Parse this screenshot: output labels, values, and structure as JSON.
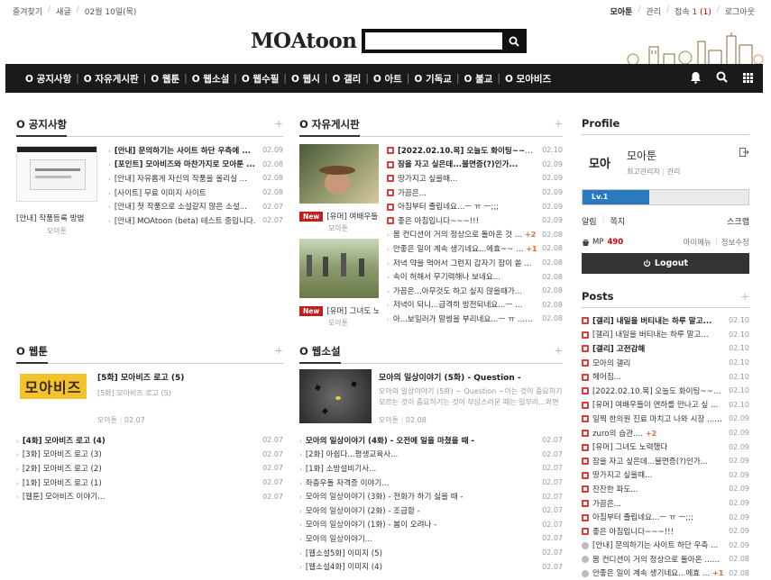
{
  "topbar": {
    "left": [
      "즐겨찾기",
      "새글",
      "02월 10일(목)"
    ],
    "user": "모아툰",
    "admin": "관리",
    "visit_prefix": "접속 1",
    "visit_count": "(1)",
    "logout": "로그아웃"
  },
  "logo": "MOAtoon",
  "search": {
    "placeholder": ""
  },
  "nav": [
    "공지사항",
    "자유게시판",
    "웹툰",
    "웹소설",
    "웹수필",
    "웹시",
    "갤리",
    "아트",
    "기독교",
    "불교",
    "모아비즈"
  ],
  "notice": {
    "title": "공지사항",
    "thumb_caption": "[안내] 작품등록 방법",
    "thumb_author": "모아툰",
    "items": [
      {
        "text": "[안내] 문의하기는 사이트 하단 우측에 ...",
        "date": "02.09",
        "bold": true
      },
      {
        "text": "[포인트] 모아비즈와 마찬가지로 모아툰 ...",
        "date": "02.08",
        "bold": true
      },
      {
        "text": "[안내] 자유롭게 자신의 작품을 올리실 ...",
        "date": "02.08",
        "bold": false
      },
      {
        "text": "[사이트] 무료 이미지 사이트",
        "date": "02.08",
        "bold": false
      },
      {
        "text": "[안내] 첫 작품으로 소설같지 않은 소설...",
        "date": "02.07",
        "bold": false
      },
      {
        "text": "[안내] MOAtoon (beta) 테스트 중입니다.",
        "date": "02.07",
        "bold": false
      }
    ]
  },
  "free": {
    "title": "자유게시판",
    "thumb1_title": "[유머] 여배우들",
    "thumb1_author": "모아툰",
    "thumb2_title": "[유머] 그녀도 노",
    "thumb2_author": "모아툰",
    "new_label": "New",
    "items": [
      {
        "text": "[2022.02.10.목] 오늘도 화이팅~~~화 ...",
        "date": "02.10",
        "icon": true,
        "bold": true,
        "badge": ""
      },
      {
        "text": "잠을 자고 싶은데...불면증(?)인가...",
        "date": "02.09",
        "icon": true,
        "bold": true,
        "badge": ""
      },
      {
        "text": "땅가지고 싶을때...",
        "date": "02.09",
        "icon": true,
        "bold": false,
        "badge": ""
      },
      {
        "text": "가끔은...",
        "date": "02.09",
        "icon": true,
        "bold": false,
        "badge": ""
      },
      {
        "text": "아침부터 졸립네요...ㅡ ㅠ ㅡ;;;",
        "date": "02.09",
        "icon": true,
        "bold": false,
        "badge": ""
      },
      {
        "text": "좋은 아침입니다~~~!!!",
        "date": "02.09",
        "icon": true,
        "bold": false,
        "badge": ""
      },
      {
        "text": "몸 컨디션이 거의 정상으로 돌아온 것 ...",
        "date": "02.08",
        "icon": false,
        "bold": false,
        "badge": "+2"
      },
      {
        "text": "안좋은 일이 계속 생기네요...에효~~ ...",
        "date": "02.08",
        "icon": false,
        "bold": false,
        "badge": "+1"
      },
      {
        "text": "저녁 약을 먹어서 그런지 갑자기 잠이 쏟 ...",
        "date": "02.08",
        "icon": false,
        "bold": false,
        "badge": ""
      },
      {
        "text": "속이 허해서 무기력해나 보네요...",
        "date": "02.08",
        "icon": false,
        "bold": false,
        "badge": ""
      },
      {
        "text": "가끔은...아무것도 하고 싶지 않을때가...",
        "date": "02.08",
        "icon": false,
        "bold": false,
        "badge": ""
      },
      {
        "text": "저녁이 되니...급격히 방전되네요...ㅡ ...",
        "date": "02.08",
        "icon": false,
        "bold": false,
        "badge": ""
      },
      {
        "text": "아...보일러가 말썽을 부리네요...ㅡ ㅠ ...",
        "date": "02.08",
        "icon": false,
        "bold": false,
        "badge": "+2"
      }
    ]
  },
  "webtoon": {
    "title": "웹툰",
    "feat_title": "[5화] 모아비즈 로고 (5)",
    "feat_desc": "[5화] 모아비즈 로고 (5)",
    "feat_author": "모아툰",
    "feat_date": "02.07",
    "thumb_text": "모아비즈",
    "items": [
      {
        "text": "[4화] 모아비즈 로고 (4)",
        "date": "02.07",
        "bold": true
      },
      {
        "text": "[3화] 모아비즈 로고 (3)",
        "date": "02.07",
        "bold": false
      },
      {
        "text": "[2화] 모아비즈 로고 (2)",
        "date": "02.07",
        "bold": false
      },
      {
        "text": "[1화] 모아비즈 로고 (1)",
        "date": "02.07",
        "bold": false
      },
      {
        "text": "[웹툰] 모아비즈 이야기...",
        "date": "02.07",
        "bold": false
      }
    ]
  },
  "novel": {
    "title": "웹소설",
    "feat_title": "모아의 일상이야기 (5화) - Question -",
    "feat_desc": "모아의 일상이야기 (5화) ~ Question ~아는 것이 중요하기 모르는 것이 중요하기는 것이 부담스러운 때는 일부러...외면",
    "feat_author": "모아툰",
    "feat_date": "02.08",
    "items": [
      {
        "text": "모아의 일상이야기 (4화) - 오전에 일을 마쳤을 때 -",
        "date": "02.07",
        "bold": true
      },
      {
        "text": "[2화] 아쉽다...평생교육사...",
        "date": "02.07",
        "bold": false
      },
      {
        "text": "[1화] 소방설비기사...",
        "date": "02.07",
        "bold": false
      },
      {
        "text": "좌충우돌 자격증 이야기...",
        "date": "02.07",
        "bold": false
      },
      {
        "text": "모아의 일상이야기 (3화) - 전화가 하기 싫을 때 -",
        "date": "02.07",
        "bold": false
      },
      {
        "text": "모아의 일상이야기 (2화) - 조급함 -",
        "date": "02.07",
        "bold": false
      },
      {
        "text": "모아의 일상이야기 (1화) - 봄이 오려나 -",
        "date": "02.07",
        "bold": false
      },
      {
        "text": "모아의 일상이야기...",
        "date": "02.07",
        "bold": false
      },
      {
        "text": "[웹소설5화] 이미지 (5)",
        "date": "02.07",
        "bold": false
      },
      {
        "text": "[웹소설4화] 이미지 (4)",
        "date": "02.07",
        "bold": false
      }
    ]
  },
  "profile": {
    "title": "Profile",
    "name": "모아툰",
    "role": "최고관리자",
    "manage": "관리",
    "avatar_text": "모아",
    "level": "Lv.1",
    "level_progress": 0.4,
    "links": [
      "알림",
      "쪽지",
      "스크랩"
    ],
    "mp_label": "MP",
    "mp_value": "490",
    "my_menu": "마이메뉴",
    "edit": "정보수정",
    "logout": "Logout"
  },
  "posts": {
    "title": "Posts",
    "items": [
      {
        "text": "[갤리] 내일을 버티내는 하루 말고...",
        "date": "02.10",
        "icon": "red",
        "bold": true,
        "badge": ""
      },
      {
        "text": "[갤리] 내일을 버티내는 하루 말고...",
        "date": "02.10",
        "icon": "red",
        "bold": false,
        "badge": ""
      },
      {
        "text": "[갤리] 고전감해",
        "date": "02.10",
        "icon": "red",
        "bold": true,
        "badge": ""
      },
      {
        "text": "모아의 갤리",
        "date": "02.10",
        "icon": "red",
        "bold": false,
        "badge": ""
      },
      {
        "text": "헤어짐...",
        "date": "02.10",
        "icon": "red",
        "bold": false,
        "badge": ""
      },
      {
        "text": "[2022.02.10.목] 오늘도 화이팅~~~화 ...",
        "date": "02.10",
        "icon": "red",
        "bold": false,
        "badge": ""
      },
      {
        "text": "[유머] 여배우들이 연하를 만나고 싶 ...",
        "date": "02.10",
        "icon": "red",
        "bold": false,
        "badge": ""
      },
      {
        "text": "일찍 한의원 진료 마치고 나와 시장 ...",
        "date": "02.09",
        "icon": "red",
        "bold": false,
        "badge": "+1"
      },
      {
        "text": "zuro의 습관....",
        "date": "02.09",
        "icon": "red",
        "bold": false,
        "badge": "+2"
      },
      {
        "text": "[유머] 그녀도 노력했다",
        "date": "02.09",
        "icon": "red",
        "bold": false,
        "badge": ""
      },
      {
        "text": "잠을 자고 싶은데...불면증(?)인가...",
        "date": "02.09",
        "icon": "red",
        "bold": false,
        "badge": ""
      },
      {
        "text": "땅가지고 싶을때...",
        "date": "02.09",
        "icon": "red",
        "bold": false,
        "badge": ""
      },
      {
        "text": "잔잔한 파도...",
        "date": "02.09",
        "icon": "red",
        "bold": false,
        "badge": ""
      },
      {
        "text": "가끔은...",
        "date": "02.09",
        "icon": "red",
        "bold": false,
        "badge": ""
      },
      {
        "text": "아침부터 졸립네요...ㅡ ㅠ ㅡ;;;",
        "date": "02.09",
        "icon": "red",
        "bold": false,
        "badge": ""
      },
      {
        "text": "좋은 아침입니다~~~!!!",
        "date": "02.09",
        "icon": "red",
        "bold": false,
        "badge": ""
      },
      {
        "text": "[안내] 문의하기는 사이트 하단 우측 ...",
        "date": "02.09",
        "icon": "grey",
        "bold": false,
        "badge": ""
      },
      {
        "text": "몸 컨디션이 거의 정상으로 돌아온 ...",
        "date": "02.08",
        "icon": "grey",
        "bold": false,
        "badge": "+2"
      },
      {
        "text": "안좋은 일이 계속 생기네요...에효 ...",
        "date": "02.08",
        "icon": "grey",
        "bold": false,
        "badge": "+1"
      }
    ]
  }
}
